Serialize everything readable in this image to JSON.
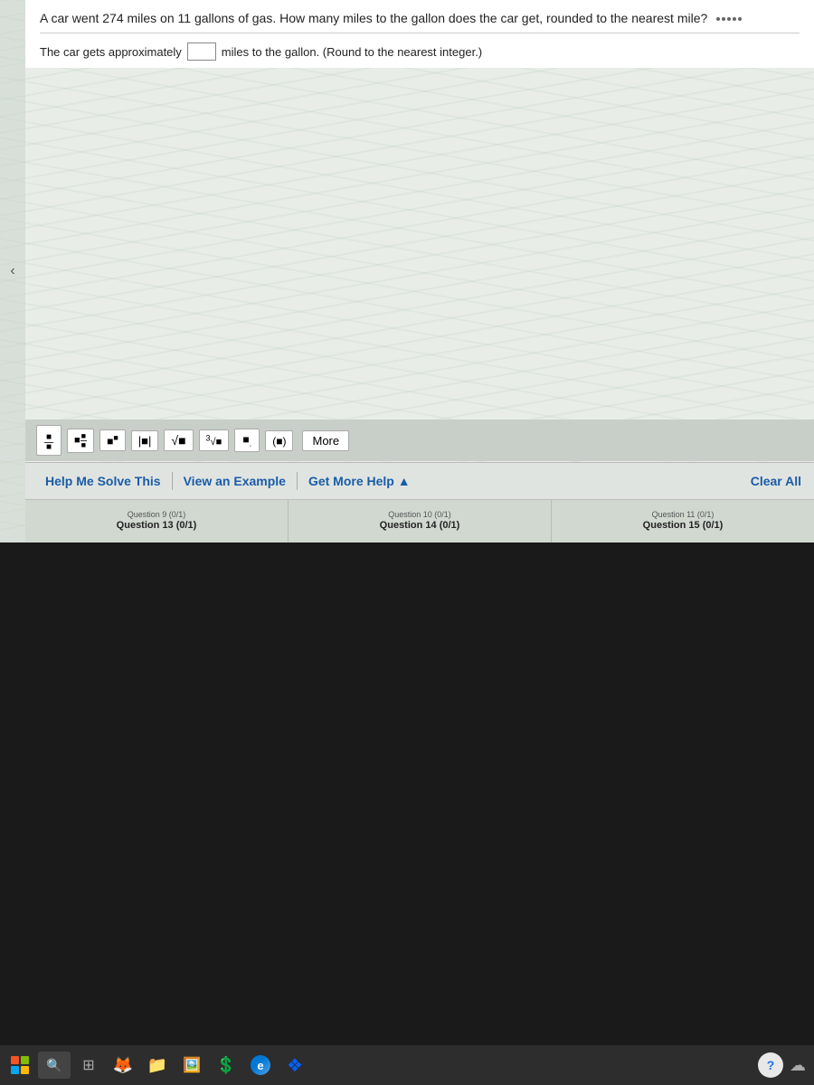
{
  "question": {
    "text": "A car went 274 miles on 11 gallons of gas. How many miles to the gallon does the car get, rounded to the nearest mile?",
    "answer_prefix": "The car gets approximately",
    "answer_suffix": "miles to the gallon. (Round to the nearest integer.)",
    "answer_value": ""
  },
  "math_toolbar": {
    "buttons": [
      {
        "label": "÷",
        "symbol": "fraction"
      },
      {
        "label": "⁺₋",
        "symbol": "mixed-fraction"
      },
      {
        "label": "■°",
        "symbol": "degree"
      },
      {
        "label": "■|■",
        "symbol": "absolute-value"
      },
      {
        "label": "√■",
        "symbol": "sqrt"
      },
      {
        "label": "∛■",
        "symbol": "cbrt"
      },
      {
        "label": "■.",
        "symbol": "decimal"
      },
      {
        "label": "(■)",
        "symbol": "parentheses"
      }
    ],
    "more_label": "More"
  },
  "help_bar": {
    "help_me_solve_label": "Help Me Solve This",
    "view_example_label": "View an Example",
    "get_more_help_label": "Get More Help ▲",
    "clear_all_label": "Clear All"
  },
  "question_nav": {
    "items": [
      {
        "small_label": "Question 9 (0/1)",
        "main_label": "Question 13 (0/1)"
      },
      {
        "small_label": "Question 10 (0/1)",
        "main_label": "Question 14 (0/1)"
      },
      {
        "small_label": "Question 11 (0/1)",
        "main_label": "Question 15 (0/1)"
      }
    ]
  },
  "taskbar": {
    "search_placeholder": "to search",
    "apps": [
      "🔥",
      "📁",
      "🖼",
      "💲",
      "🌐",
      "❖"
    ]
  }
}
